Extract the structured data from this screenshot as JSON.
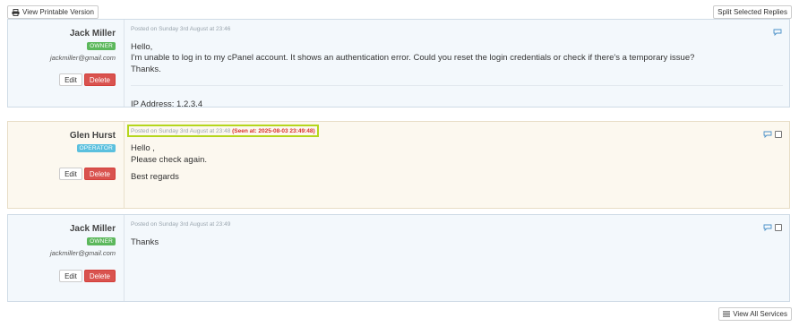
{
  "toolbar": {
    "printable_label": "View Printable Version",
    "split_label": "Split Selected Replies",
    "view_services_label": "View All Services"
  },
  "replies": [
    {
      "author": "Jack Miller",
      "role": "OWNER",
      "email": "jackmiller@gmail.com",
      "edit": "Edit",
      "delete": "Delete",
      "posted": "Posted on Sunday 3rd August at 23:46",
      "lines": [
        "Hello,",
        "I'm unable to log in to my cPanel account. It shows an authentication error. Could you reset the login credentials or check if there's a temporary issue?",
        "Thanks."
      ],
      "ip": "IP Address: 1.2.3.4"
    },
    {
      "author": "Glen Hurst",
      "role": "OPERATOR",
      "edit": "Edit",
      "delete": "Delete",
      "posted": "Posted on Sunday 3rd August at 23:48",
      "seen": "(Seen at: 2025-08-03 23:49:48)",
      "lines": [
        "Hello ,",
        "Please check again.",
        "Best regards"
      ]
    },
    {
      "author": "Jack Miller",
      "role": "OWNER",
      "email": "jackmiller@gmail.com",
      "edit": "Edit",
      "delete": "Delete",
      "posted": "Posted on Sunday 3rd August at 23:49",
      "lines": [
        "Thanks"
      ]
    }
  ],
  "colors": {
    "owner_badge": "#5cb85c",
    "operator_badge": "#5bc0de",
    "delete": "#d9534f",
    "highlight": "#b5d61c"
  },
  "icons": [
    "printer-icon",
    "comment-icon",
    "list-icon"
  ]
}
